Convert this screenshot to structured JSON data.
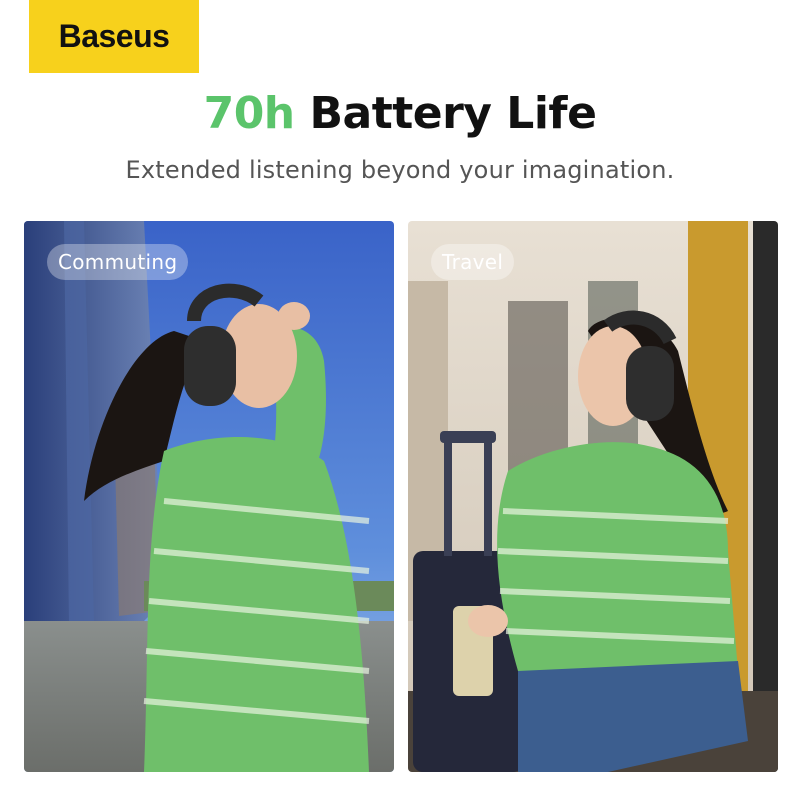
{
  "brand": {
    "logo_text": "Baseus",
    "logo_color": "#f7d11c"
  },
  "headline": {
    "accent": "70h",
    "rest": "Battery Life",
    "accent_color": "#5bc46b"
  },
  "subline": "Extended listening beyond your imagination.",
  "scenes": [
    {
      "label": "Commuting",
      "image": "woman-in-green-sweater-wearing-headphones-looking-up-city"
    },
    {
      "label": "Travel",
      "image": "woman-sitting-by-suitcase-with-drink-wearing-headphones"
    }
  ]
}
